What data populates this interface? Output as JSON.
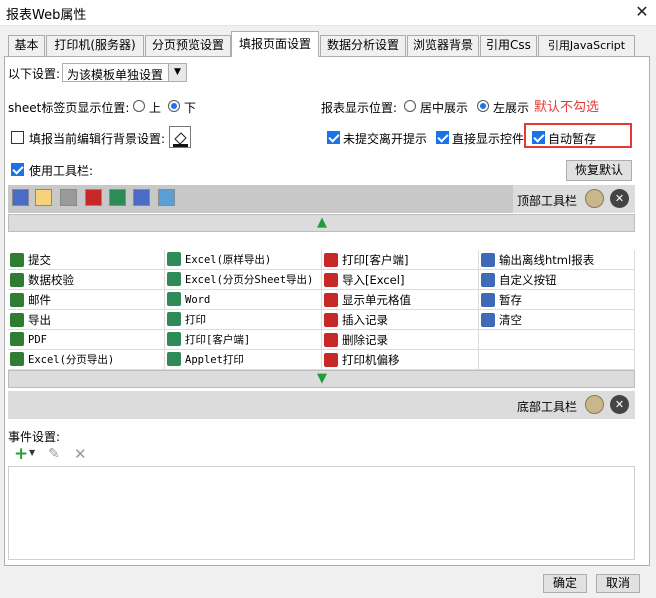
{
  "window": {
    "title": "报表Web属性",
    "close_glyph": "✕"
  },
  "tabs": [
    {
      "label": "基本"
    },
    {
      "label": "打印机(服务器)"
    },
    {
      "label": "分页预览设置"
    },
    {
      "label": "填报页面设置"
    },
    {
      "label": "数据分析设置"
    },
    {
      "label": "浏览器背景"
    },
    {
      "label": "引用Css"
    },
    {
      "label": "引用JavaScript"
    }
  ],
  "settings": {
    "scope_label": "以下设置:",
    "scope_value": "为该模板单独设置",
    "sheet_pos_label": "sheet标签页显示位置:",
    "sheet_top": "上",
    "sheet_bottom": "下",
    "report_pos_label": "报表显示位置:",
    "center": "居中展示",
    "left": "左展示",
    "annotation": "默认不勾选",
    "row_bg_label": "填报当前编辑行背景设置:",
    "no_leave_prompt": "未提交离开提示",
    "show_direct": "直接显示控件",
    "auto_save": "自动暂存",
    "use_toolbar": "使用工具栏:",
    "restore_default": "恢复默认",
    "top_toolbar": "顶部工具栏",
    "bottom_toolbar": "底部工具栏"
  },
  "buttons_grid": [
    [
      "提交",
      "Excel(原样导出)",
      "打印[客户端]",
      "输出离线html报表"
    ],
    [
      "数据校验",
      "Excel(分页分Sheet导出)",
      "导入[Excel]",
      "自定义按钮"
    ],
    [
      "邮件",
      "Word",
      "显示单元格值",
      "暂存"
    ],
    [
      "导出",
      "打印",
      "插入记录",
      "清空"
    ],
    [
      "PDF",
      "打印[客户端]",
      "删除记录",
      ""
    ],
    [
      "Excel(分页导出)",
      "Applet打印",
      "打印机偏移",
      ""
    ]
  ],
  "events": {
    "label": "事件设置:"
  },
  "footer": {
    "ok": "确定",
    "cancel": "取消"
  },
  "colors": {
    "accent": "#1a73e8",
    "annotation": "#e53935",
    "toolbar_bg": "#c8c8c8",
    "green_arrow": "#1e9e3a"
  }
}
